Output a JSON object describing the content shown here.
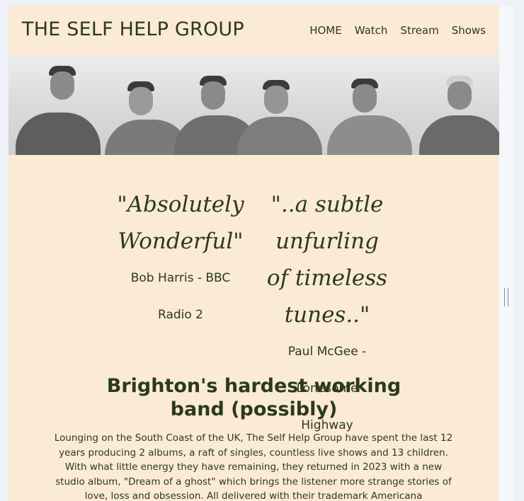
{
  "header": {
    "site_title": "THE SELF HELP GROUP",
    "nav": [
      "HOME",
      "Watch",
      "Stream",
      "Shows"
    ]
  },
  "hero": {
    "image_icon": "band-photo"
  },
  "quotes": [
    {
      "lines": [
        "\"Absolutely",
        "Wonderful\""
      ],
      "attribution_lines": [
        "Bob Harris - BBC",
        "Radio 2"
      ]
    },
    {
      "lines": [
        "\"..a subtle",
        "unfurling",
        "of timeless",
        "tunes..\""
      ],
      "attribution_lines": [
        "Paul McGee -",
        "Lonesome",
        "Highway"
      ]
    }
  ],
  "main": {
    "headline": "Brighton's hardest working band (possibly)",
    "body": "Lounging on the South Coast of the UK, The Self Help Group have spent the last 12 years producing 2 albums, a raft of singles, countless live shows and 13 children. With what little energy they have remaining, they returned in 2023 with a new studio album, \"Dream of a ghost\" which brings the listener more strange stories of love, loss and obsession. All delivered with their trademark Americana"
  },
  "colors": {
    "page_background": "#fbead6",
    "text": "#2a3a1e",
    "outer_background": "#eef1f7"
  }
}
